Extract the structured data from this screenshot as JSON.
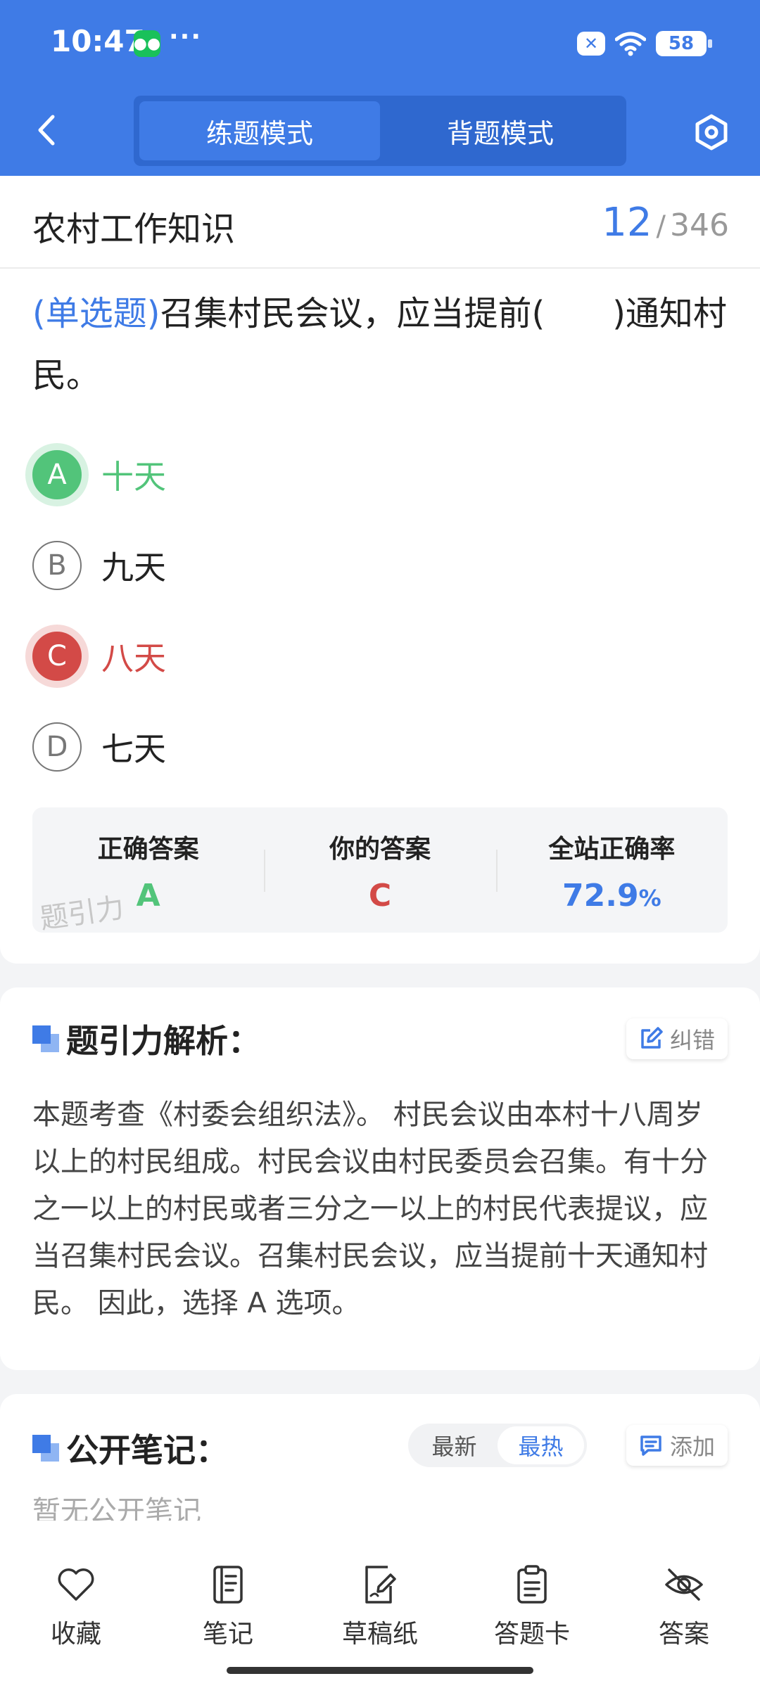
{
  "status_bar": {
    "time": "10:47",
    "dots": "···",
    "battery": "58"
  },
  "header": {
    "tabs": [
      {
        "label": "练题模式",
        "active": true
      },
      {
        "label": "背题模式",
        "active": false
      }
    ]
  },
  "subject": {
    "title": "农村工作知识",
    "current": "12",
    "separator": "/",
    "total": "346"
  },
  "question": {
    "type": "(单选题)",
    "text": "召集村民会议，应当提前(　　)通知村民。"
  },
  "options": [
    {
      "letter": "A",
      "text": "十天",
      "state": "correct"
    },
    {
      "letter": "B",
      "text": "九天",
      "state": "normal"
    },
    {
      "letter": "C",
      "text": "八天",
      "state": "wrong"
    },
    {
      "letter": "D",
      "text": "七天",
      "state": "normal"
    }
  ],
  "answer_summary": {
    "correct_label": "正确答案",
    "correct_value": "A",
    "yours_label": "你的答案",
    "yours_value": "C",
    "rate_label": "全站正确率",
    "rate_value": "72.9",
    "rate_unit": "%",
    "watermark": "题引力"
  },
  "analysis": {
    "title": "题引力解析：",
    "report_label": "纠错",
    "text": "本题考查《村委会组织法》。 村民会议由本村十八周岁以上的村民组成。村民会议由村民委员会召集。有十分之一以上的村民或者三分之一以上的村民代表提议，应当召集村民会议。召集村民会议，应当提前十天通知村民。 因此，选择 A 选项。"
  },
  "notes": {
    "title": "公开笔记：",
    "sort_options": [
      {
        "label": "最新",
        "active": false
      },
      {
        "label": "最热",
        "active": true
      }
    ],
    "add_label": "添加",
    "empty_text": "暂无公开笔记"
  },
  "bottom_nav": [
    {
      "label": "收藏",
      "icon": "heart-icon"
    },
    {
      "label": "笔记",
      "icon": "notebook-icon"
    },
    {
      "label": "草稿纸",
      "icon": "draft-pen-icon"
    },
    {
      "label": "答题卡",
      "icon": "clipboard-icon"
    },
    {
      "label": "答案",
      "icon": "eye-off-icon"
    }
  ],
  "colors": {
    "primary": "#3f7be6",
    "correct": "#52c47a",
    "wrong": "#d34a47"
  }
}
